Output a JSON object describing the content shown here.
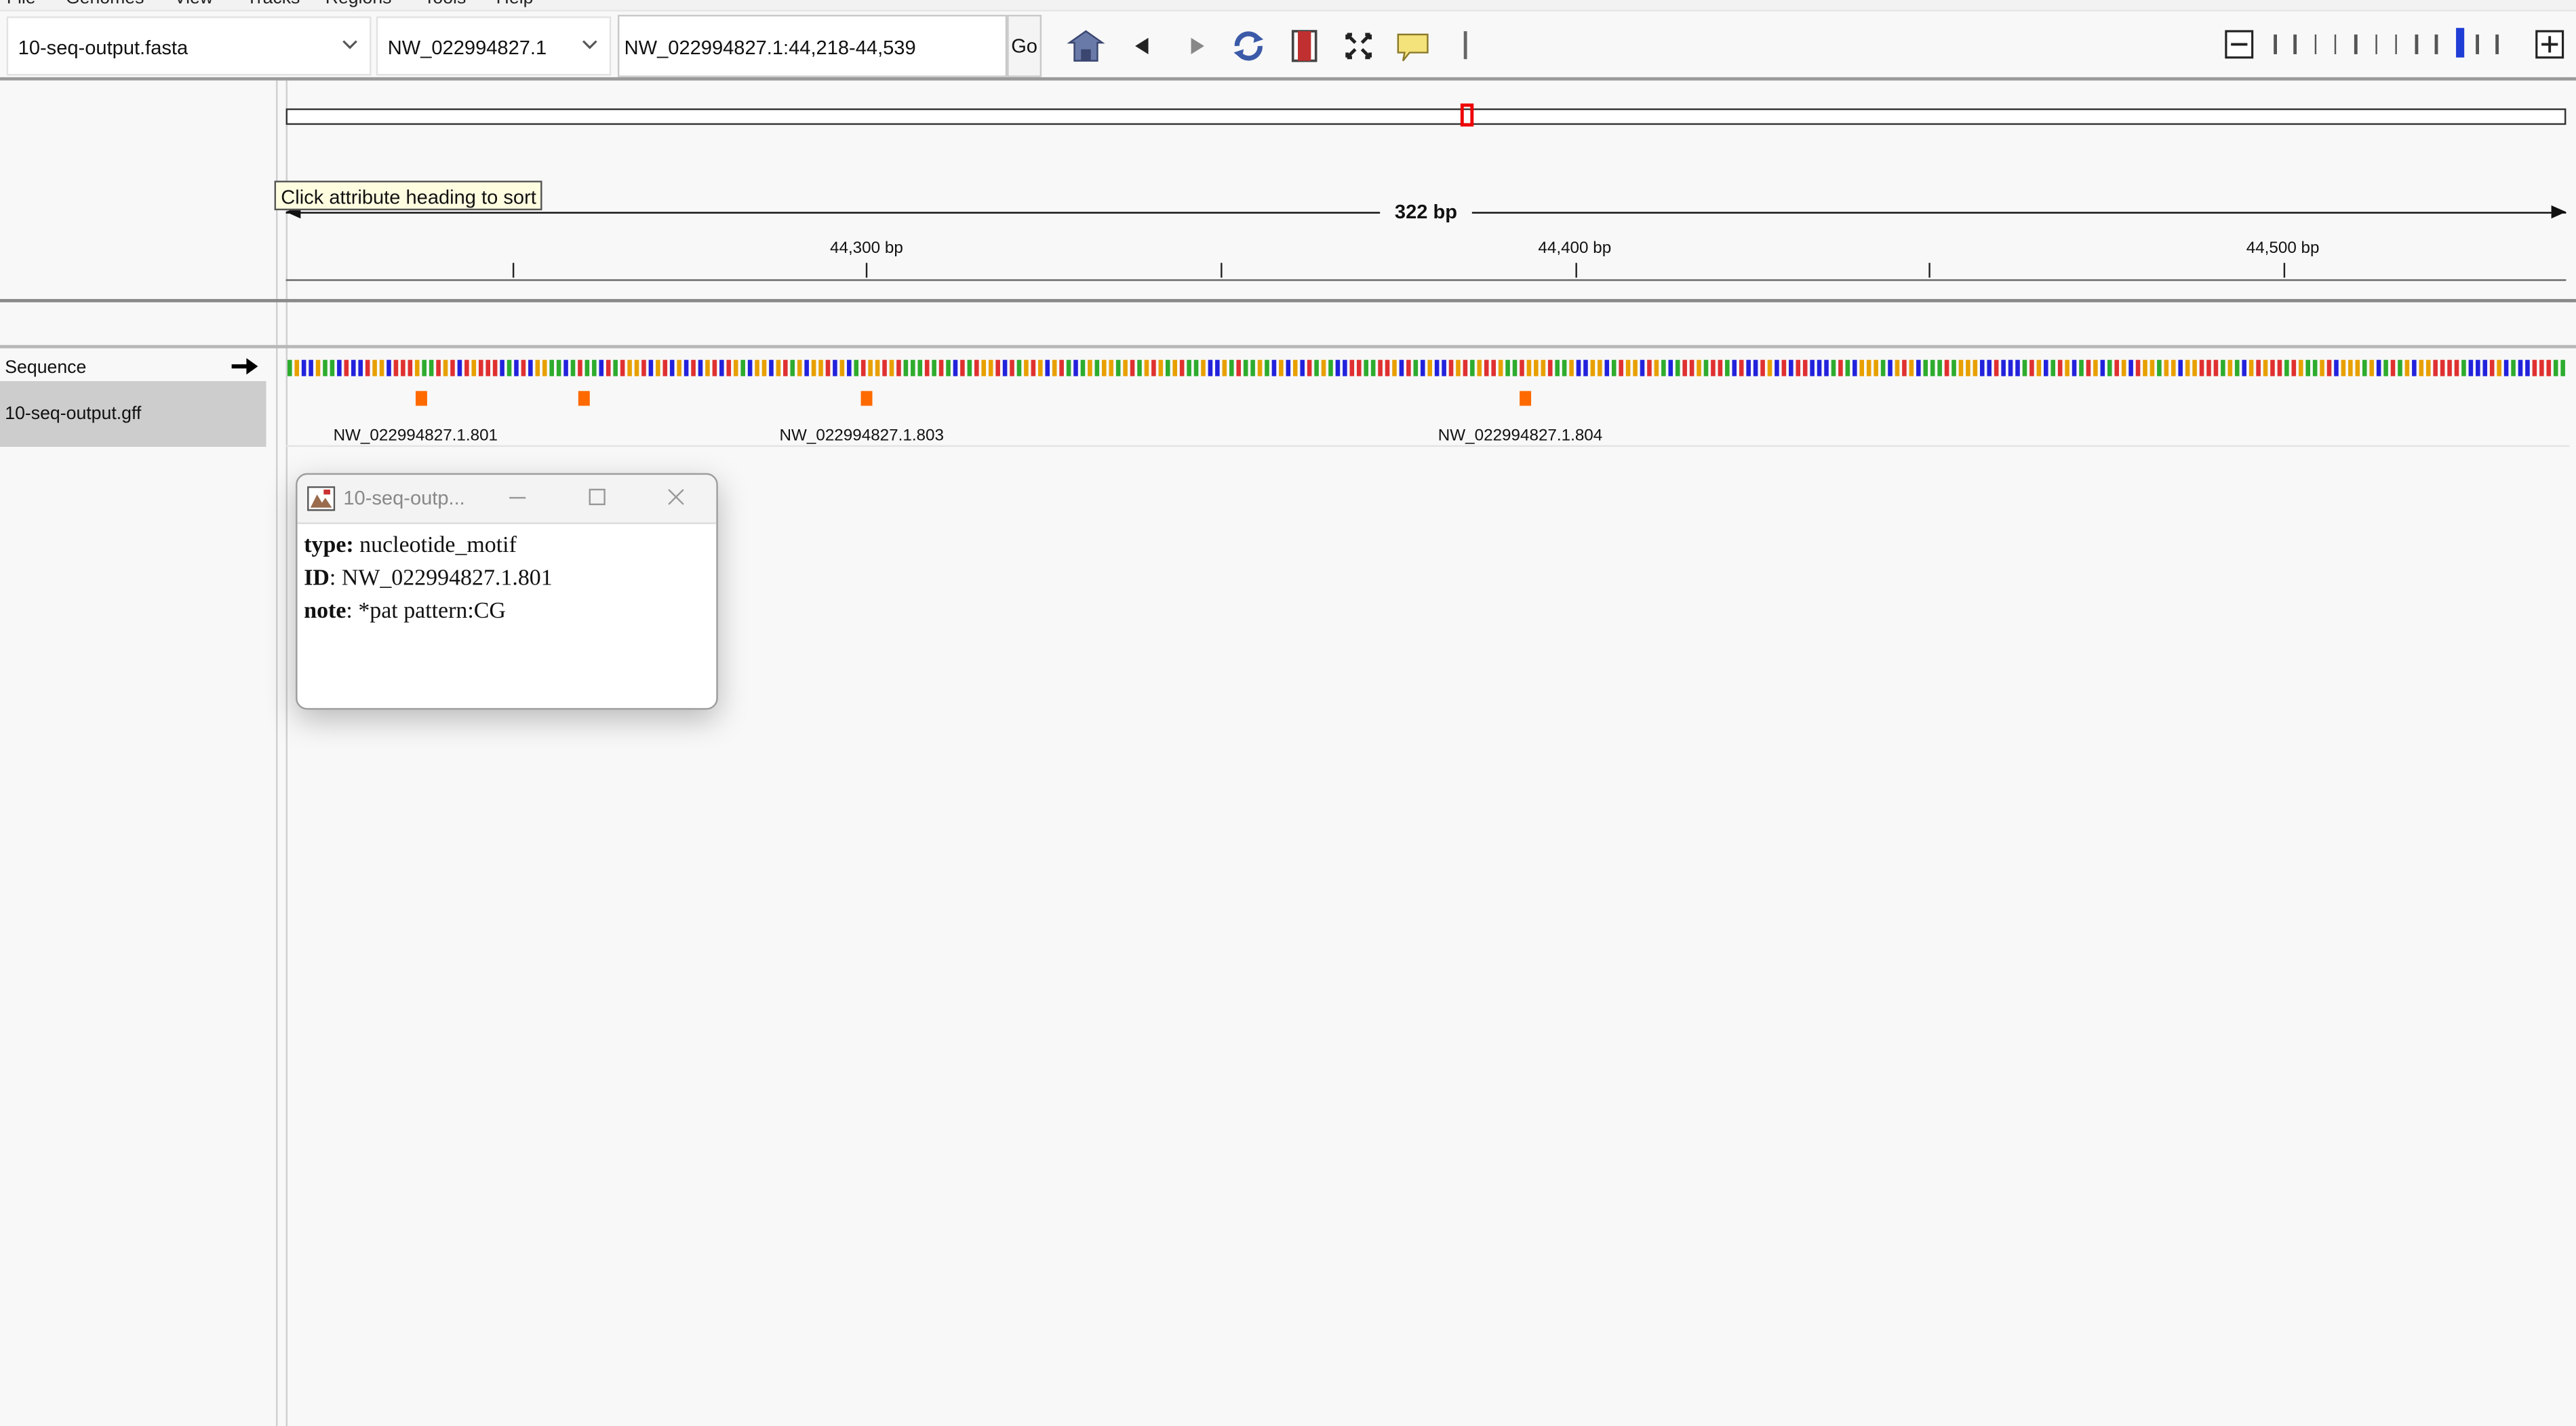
{
  "menu": {
    "items": [
      "File",
      "Genomes",
      "View",
      "Tracks",
      "Regions",
      "Tools",
      "Help"
    ]
  },
  "toolbar": {
    "genome": "10-seq-output.fasta",
    "chromosome": "NW_022994827.1",
    "locus": "NW_022994827.1:44,218-44,539",
    "go_label": "Go",
    "icons": [
      "home-icon",
      "back-icon",
      "forward-icon",
      "refresh-icon",
      "roi-icon",
      "fit-window-icon",
      "popup-info-icon",
      "divider-icon"
    ]
  },
  "ruler": {
    "span_label": "322 bp",
    "ticks": [
      {
        "pos": 44250,
        "label": ""
      },
      {
        "pos": 44300,
        "label": "44,300 bp"
      },
      {
        "pos": 44350,
        "label": ""
      },
      {
        "pos": 44400,
        "label": "44,400 bp"
      },
      {
        "pos": 44450,
        "label": ""
      },
      {
        "pos": 44500,
        "label": "44,500 bp"
      }
    ],
    "start": 44218,
    "end": 44539
  },
  "tooltip": "Click attribute heading to sort",
  "tracks": {
    "sequence_name": "Sequence",
    "gff_name": "10-seq-output.gff",
    "features": [
      {
        "pos": 44237,
        "label": "NW_022994827.1.801"
      },
      {
        "pos": 44260,
        "label": ""
      },
      {
        "pos": 44300,
        "label": "NW_022994827.1.803"
      },
      {
        "pos": 44393,
        "label": "NW_022994827.1.804"
      }
    ],
    "base_colors": {
      "A": "#2dac2d",
      "C": "#2222dd",
      "G": "#e8a000",
      "T": "#e03030"
    }
  },
  "popup": {
    "title": "10-seq-outp...",
    "type_key": "type:",
    "type_val": " nucleotide_motif",
    "id_key": "ID",
    "id_val": ": NW_022994827.1.801",
    "note_key": "note",
    "note_val": ": *pat pattern:CG"
  }
}
